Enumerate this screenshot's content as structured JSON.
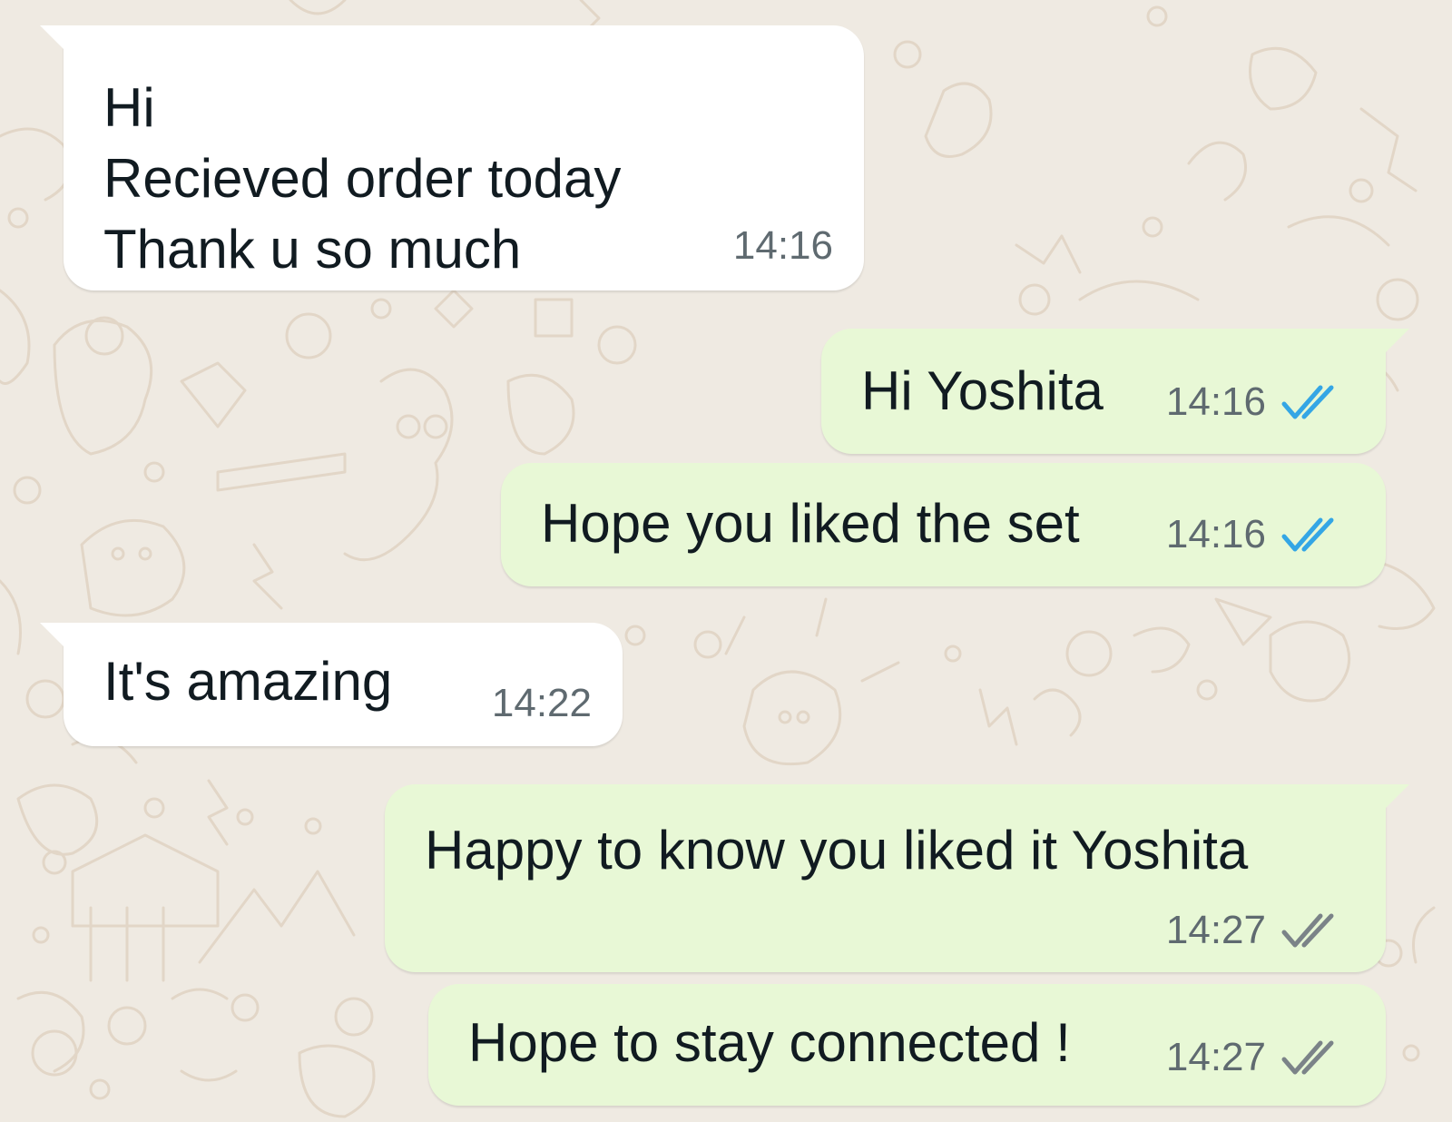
{
  "messages": [
    {
      "direction": "incoming",
      "lines": [
        "Hi",
        "Recieved order today",
        "Thank u so much"
      ],
      "time": "14:16"
    },
    {
      "direction": "outgoing",
      "text": "Hi Yoshita",
      "time": "14:16",
      "status": "read",
      "tick_icon": "double-check-icon"
    },
    {
      "direction": "outgoing",
      "text": "Hope you liked the set",
      "time": "14:16",
      "status": "read",
      "tick_icon": "double-check-icon"
    },
    {
      "direction": "incoming",
      "text": "It's amazing",
      "time": "14:22"
    },
    {
      "direction": "outgoing",
      "text": "Happy to know you liked it Yoshita",
      "time": "14:27",
      "status": "delivered",
      "tick_icon": "double-check-icon"
    },
    {
      "direction": "outgoing",
      "text": "Hope to stay connected !",
      "time": "14:27",
      "status": "delivered",
      "tick_icon": "double-check-icon"
    }
  ],
  "colors": {
    "wallpaper": "#efeae2",
    "incoming_bubble": "#ffffff",
    "outgoing_bubble": "#e8f8d6",
    "text": "#111b21",
    "timestamp": "#5f6a70",
    "tick_read": "#34a6e5",
    "tick_delivered": "#7b8388"
  }
}
